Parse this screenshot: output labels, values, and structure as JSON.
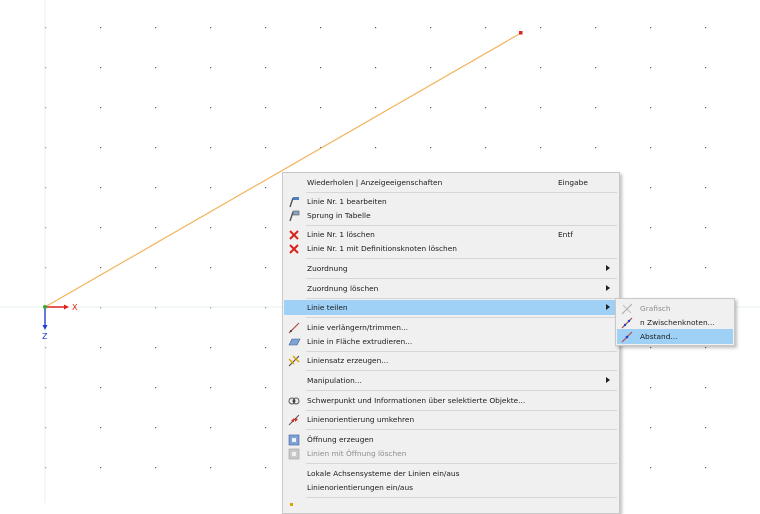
{
  "axes": {
    "x_label": "X",
    "z_label": "Z"
  },
  "colors": {
    "line": "#f2b35a",
    "x_axis": "#e0201b",
    "z_axis": "#1f3fd1",
    "highlight": "#9fd1f7"
  },
  "context_menu": {
    "repeat": {
      "label": "Wiederholen | Anzeigeeigenschaften",
      "shortcut": "Eingabe"
    },
    "edit_line": {
      "label": "Linie Nr. 1 bearbeiten",
      "icon": "edit-line-icon"
    },
    "jump_table": {
      "label": "Sprung in Tabelle",
      "icon": "table-jump-icon"
    },
    "delete_line": {
      "label": "Linie Nr. 1 löschen",
      "shortcut": "Entf",
      "icon": "delete-icon"
    },
    "delete_with_nodes": {
      "label": "Linie Nr. 1 mit Definitionsknoten löschen",
      "icon": "delete-icon"
    },
    "assignment": {
      "label": "Zuordnung"
    },
    "delete_assignment": {
      "label": "Zuordnung löschen"
    },
    "divide_line": {
      "label": "Linie teilen"
    },
    "extend_trim": {
      "label": "Linie verlängern/trimmen...",
      "icon": "extend-line-icon"
    },
    "extrude": {
      "label": "Linie in Fläche extrudieren...",
      "icon": "extrude-surface-icon"
    },
    "line_set": {
      "label": "Liniensatz erzeugen...",
      "icon": "line-set-icon"
    },
    "manipulation": {
      "label": "Manipulation..."
    },
    "centroid": {
      "label": "Schwerpunkt und Informationen über selektierte Objekte...",
      "icon": "centroid-info-icon"
    },
    "reverse": {
      "label": "Linienorientierung umkehren",
      "icon": "reverse-orientation-icon"
    },
    "create_opening": {
      "label": "Öffnung erzeugen",
      "icon": "opening-icon"
    },
    "delete_opening": {
      "label": "Linien mit Öffnung löschen",
      "icon": "opening-delete-icon"
    },
    "local_axes": {
      "label": "Lokale Achsensysteme der Linien ein/aus"
    },
    "orientations": {
      "label": "Linienorientierungen ein/aus"
    }
  },
  "submenu": {
    "graphical": {
      "label": "Grafisch",
      "icon": "graphical-divide-icon"
    },
    "n_nodes": {
      "label": "n Zwischenknoten...",
      "icon": "n-nodes-icon"
    },
    "distance": {
      "label": "Abstand...",
      "icon": "distance-divide-icon"
    }
  }
}
